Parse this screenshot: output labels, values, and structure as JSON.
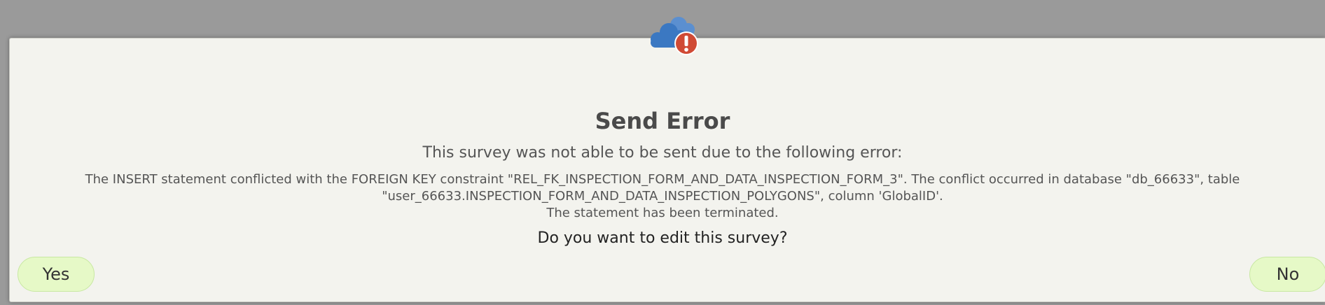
{
  "dialog": {
    "title": "Send Error",
    "subtitle": "This survey was not able to be sent due to the following error:",
    "message_lines": [
      "The INSERT statement conflicted with the FOREIGN KEY constraint \"REL_FK_INSPECTION_FORM_AND_DATA_INSPECTION_FORM_3\". The conflict occurred in database \"db_66633\", table \"user_66633.INSPECTION_FORM_AND_DATA_INSPECTION_POLYGONS\", column 'GlobalID'.",
      "The statement has been terminated."
    ],
    "question": "Do you want to edit this survey?",
    "yes_label": "Yes",
    "no_label": "No",
    "icon": "cloud-error-icon"
  },
  "colors": {
    "cloud_blue": "#3b78c2",
    "error_red": "#d04a35",
    "button_green": "#e6f9c7",
    "dialog_bg": "#f3f3ee"
  }
}
